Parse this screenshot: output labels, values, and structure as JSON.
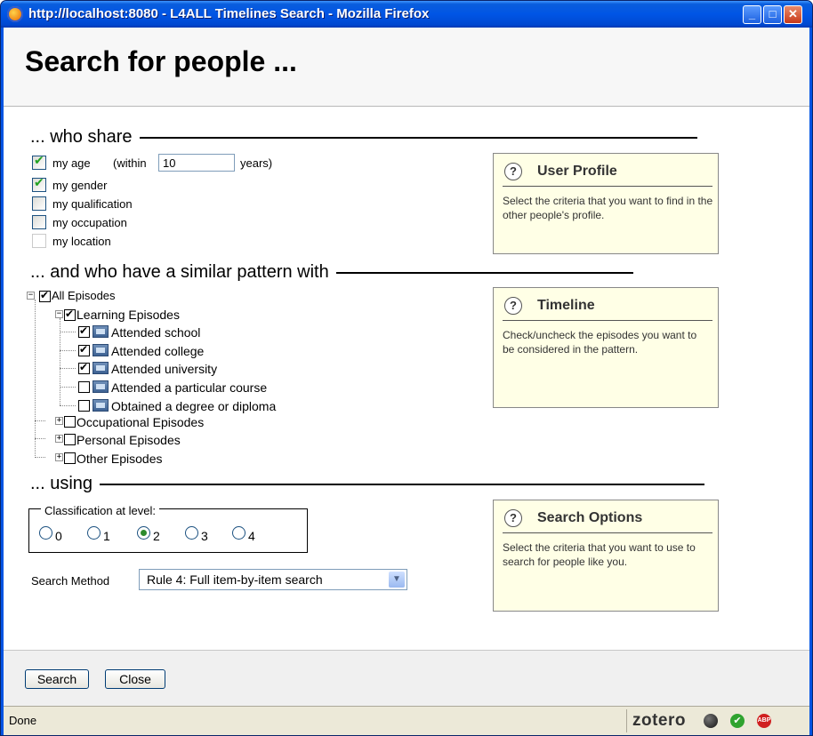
{
  "window": {
    "title": "http://localhost:8080 - L4ALL Timelines Search - Mozilla Firefox",
    "minimize_label": "_",
    "maximize_label": "□",
    "close_label": "✕"
  },
  "page": {
    "heading": "Search for people ..."
  },
  "share": {
    "heading": "... who share",
    "age": {
      "label": "my age",
      "within_label": "(within",
      "value": "10",
      "years_label": "years)",
      "checked": true
    },
    "gender": {
      "label": "my gender",
      "checked": true
    },
    "qualification": {
      "label": "my qualification",
      "checked": false
    },
    "occupation": {
      "label": "my occupation",
      "checked": false
    },
    "location": {
      "label": "my location",
      "checked": false
    }
  },
  "pattern": {
    "heading": "... and who have a similar pattern with",
    "all": "All Episodes",
    "learning": "Learning Episodes",
    "items": [
      "Attended school",
      "Attended college",
      "Attended university",
      "Attended a particular course",
      "Obtained a degree or diploma"
    ],
    "occupational": "Occupational Episodes",
    "personal": "Personal Episodes",
    "other": "Other Episodes"
  },
  "using": {
    "heading": "... using",
    "classification_label": "Classification at level:",
    "levels": [
      "0",
      "1",
      "2",
      "3",
      "4"
    ],
    "selected_level": "2",
    "method_label": "Search Method",
    "method_value": "Rule 4: Full item-by-item search"
  },
  "panels": {
    "profile": {
      "title": "User Profile",
      "text": "Select the criteria that you want to find in the other people's profile."
    },
    "timeline": {
      "title": "Timeline",
      "text": "Check/uncheck the episodes you want to be considered in the pattern."
    },
    "search": {
      "title": "Search Options",
      "text": "Select the criteria that you want to use to search for people like you."
    }
  },
  "buttons": {
    "search": "Search",
    "close": "Close"
  },
  "status": {
    "text": "Done",
    "zotero": "zotero"
  }
}
